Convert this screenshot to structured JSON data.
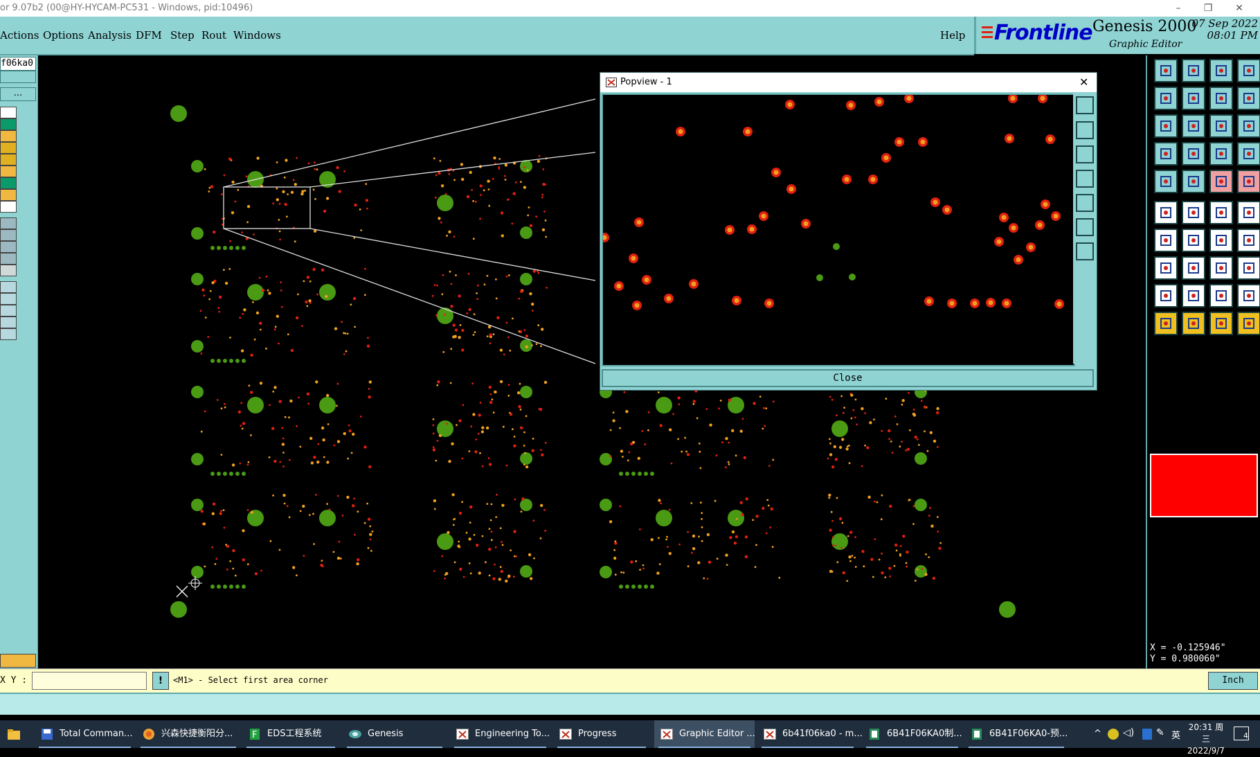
{
  "window": {
    "title": "or 9.07b2 (00@HY-HYCAM-PC531 - Windows, pid:10496)"
  },
  "menubar": {
    "items": [
      "Actions",
      "Options",
      "Analysis",
      "DFM",
      "Step",
      "Rout",
      "Windows"
    ],
    "help": "Help"
  },
  "brand": {
    "logo": "Frontline",
    "product": "Genesis 2000",
    "subtitle": "Graphic Editor",
    "date_line1": "07 Sep 2022",
    "date_line2": "08:01 PM"
  },
  "left_panel": {
    "job_name": "f06ka0",
    "more_button": "..."
  },
  "popview": {
    "title": "Popview - 1",
    "close_button": "Close"
  },
  "command_bar": {
    "xy_label": "X Y :",
    "input_value": "",
    "bang_label": "!",
    "message": "<M1> - Select first area corner",
    "units": "Inch"
  },
  "coords": {
    "x": "X = -0.125946\"",
    "y": "Y = 0.980060\""
  },
  "taskbar": {
    "items": [
      {
        "label": "Total Comman...",
        "icon": "total-commander-icon"
      },
      {
        "label": "兴森快捷衡阳分...",
        "icon": "browser-icon"
      },
      {
        "label": "EDS工程系统",
        "icon": "eds-icon"
      },
      {
        "label": "Genesis",
        "icon": "genesis-icon"
      },
      {
        "label": "Engineering To...",
        "icon": "genesis-window-icon"
      },
      {
        "label": "Progress",
        "icon": "genesis-window-icon"
      },
      {
        "label": "Graphic Editor ...",
        "icon": "genesis-window-icon"
      },
      {
        "label": "6b41f06ka0 - m...",
        "icon": "genesis-window-icon"
      },
      {
        "label": "6B41F06KA0制...",
        "icon": "spreadsheet-icon"
      },
      {
        "label": "6B41F06KA0-预...",
        "icon": "spreadsheet-icon"
      }
    ],
    "clock_time": "20:31 周三",
    "clock_date": "2022/9/7",
    "ime": "英",
    "notification_count": "4"
  },
  "colors": {
    "panel": "#8fd3d3",
    "pad_green": "#4a9a14",
    "pad_red": "#e02010",
    "pad_orange": "#f0a020",
    "highlight_red": "#ff0000"
  }
}
